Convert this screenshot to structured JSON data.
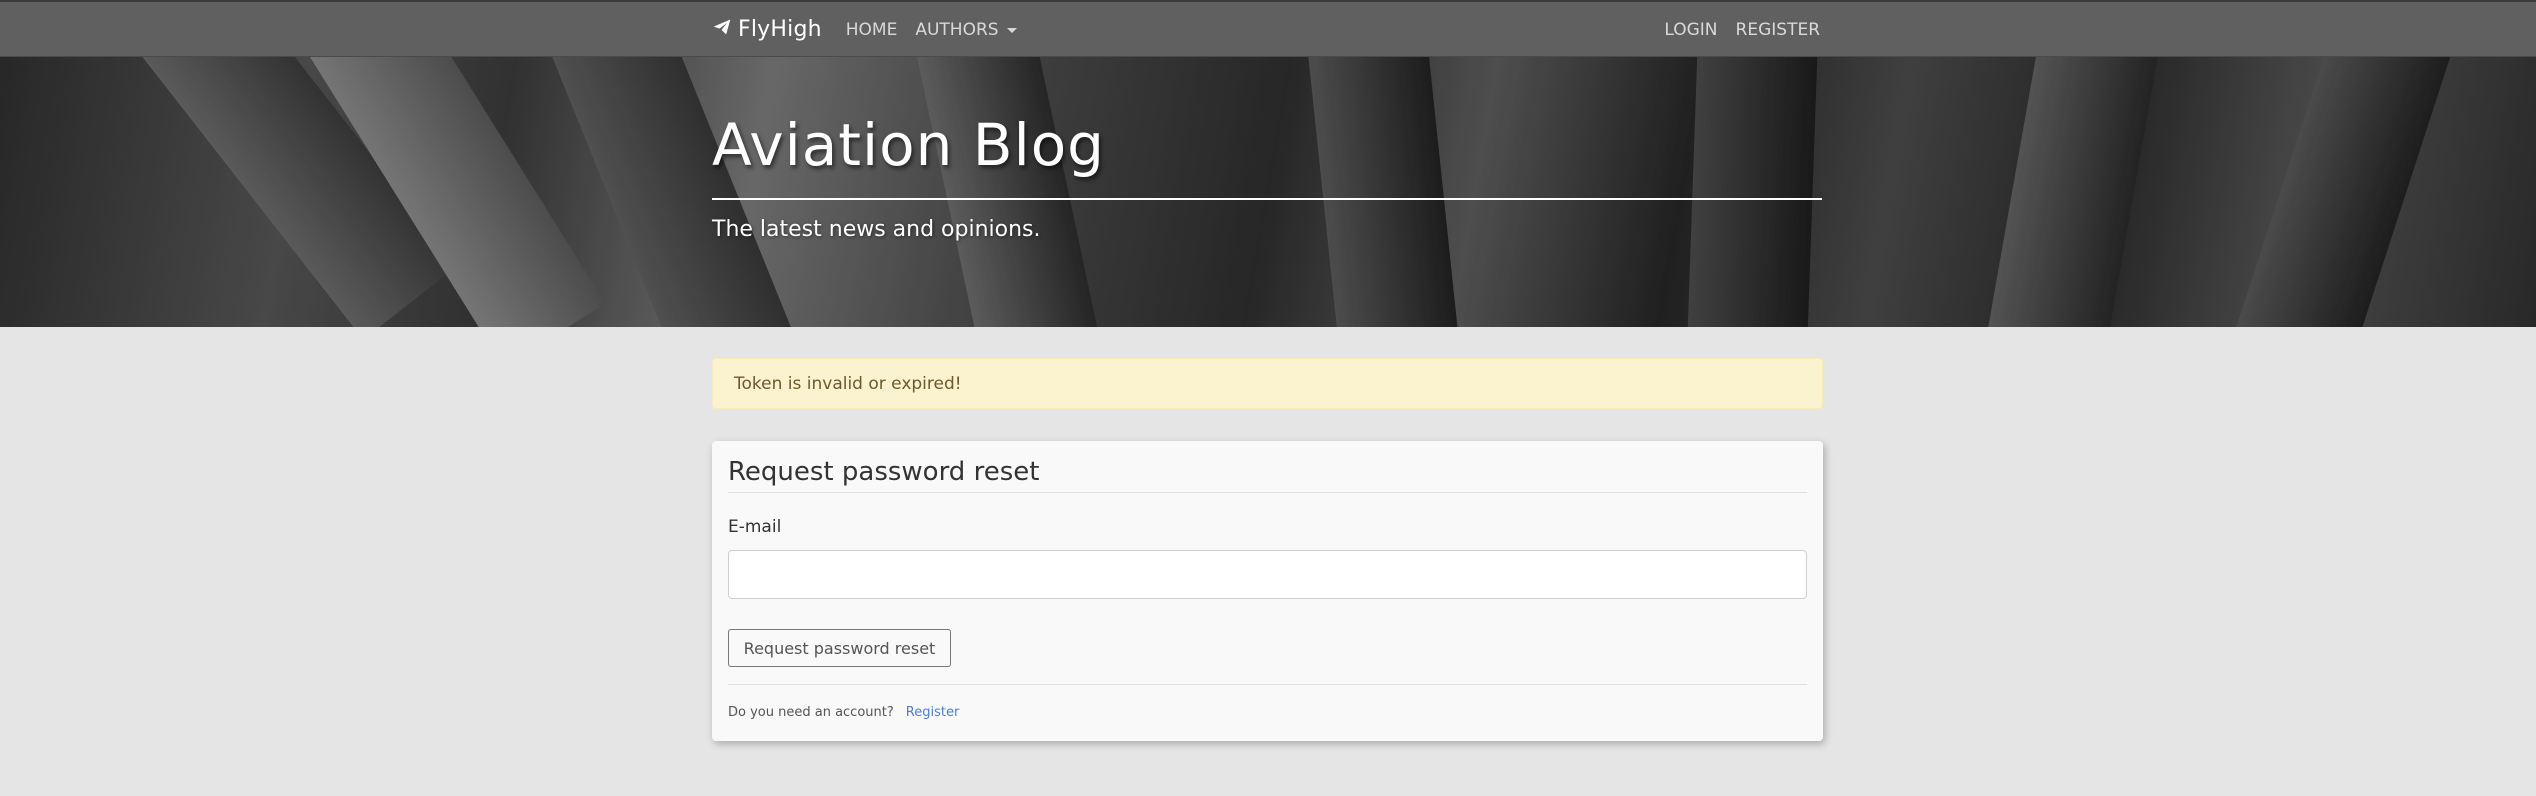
{
  "navbar": {
    "brand": "FlyHigh",
    "brand_icon": "paper-plane-icon",
    "links": [
      {
        "label": "HOME"
      },
      {
        "label": "AUTHORS"
      }
    ],
    "right_links": [
      {
        "label": "LOGIN"
      },
      {
        "label": "REGISTER"
      }
    ]
  },
  "hero": {
    "title": "Aviation Blog",
    "subtitle": "The latest news and opinions."
  },
  "alert": {
    "message": "Token is invalid or expired!",
    "color": "#fbf3cf"
  },
  "form": {
    "title": "Request password reset",
    "email_label": "E-mail",
    "email_value": "",
    "email_placeholder": "",
    "submit_label": "Request password reset",
    "footer_text": "Do you need an account?",
    "footer_link": "Register",
    "link_color": "#4a7fd4"
  }
}
